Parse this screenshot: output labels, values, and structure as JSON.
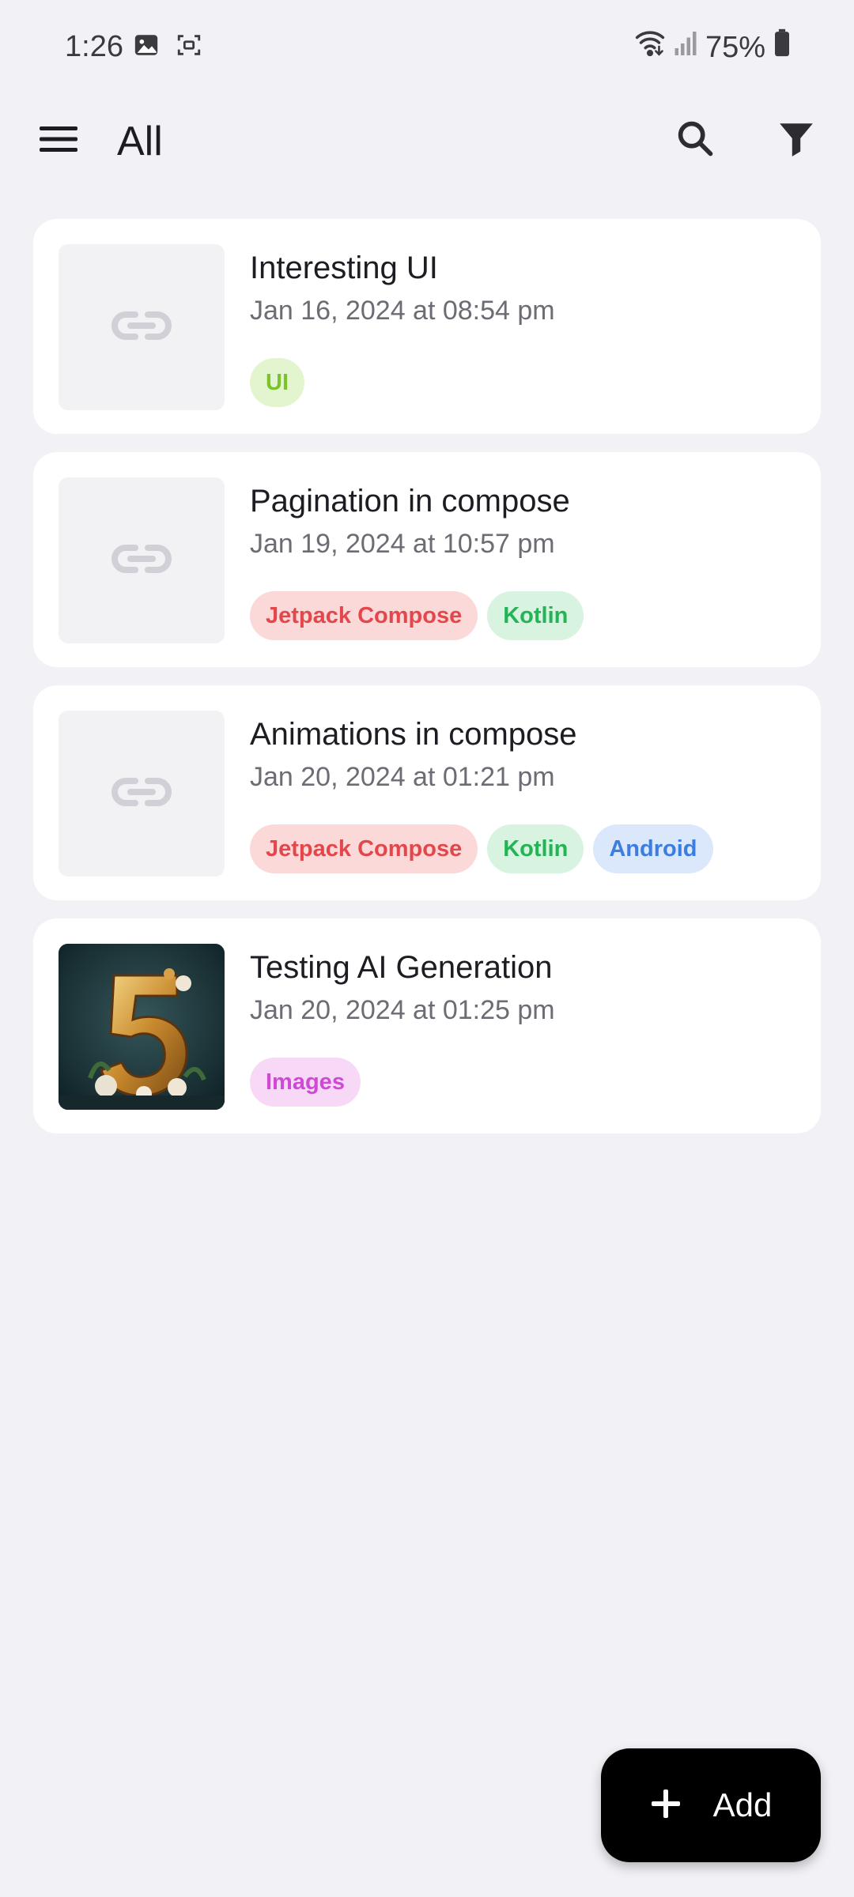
{
  "status_bar": {
    "time": "1:26",
    "battery": "75%",
    "icons": [
      "gallery-icon",
      "screenshot-icon",
      "wifi-icon",
      "signal-icon",
      "battery-icon"
    ]
  },
  "app_bar": {
    "title": "All",
    "icons": [
      "menu-icon",
      "search-icon",
      "filter-icon"
    ]
  },
  "colors": {
    "background": "#f1f1f6",
    "card": "#ffffff",
    "fab": "#000000"
  },
  "cards": [
    {
      "title": "Interesting UI",
      "date": "Jan 16, 2024 at 08:54 pm",
      "thumbnail": "link-icon",
      "tags": [
        {
          "label": "UI",
          "bg": "#e3f5cf",
          "fg": "#7cc22b"
        }
      ]
    },
    {
      "title": "Pagination in compose",
      "date": "Jan 19, 2024 at 10:57 pm",
      "thumbnail": "link-icon",
      "tags": [
        {
          "label": "Jetpack Compose",
          "bg": "#fbd9d9",
          "fg": "#e3474b"
        },
        {
          "label": "Kotlin",
          "bg": "#d8f3df",
          "fg": "#22b455"
        }
      ]
    },
    {
      "title": "Animations in compose",
      "date": "Jan 20, 2024 at 01:21 pm",
      "thumbnail": "link-icon",
      "tags": [
        {
          "label": "Jetpack Compose",
          "bg": "#fbd9d9",
          "fg": "#e3474b"
        },
        {
          "label": "Kotlin",
          "bg": "#d8f3df",
          "fg": "#22b455"
        },
        {
          "label": "Android",
          "bg": "#dbe7fa",
          "fg": "#3b7de0"
        }
      ]
    },
    {
      "title": "Testing AI Generation",
      "date": "Jan 20, 2024 at 01:25 pm",
      "thumbnail": "image-thumbnail",
      "tags": [
        {
          "label": "Images",
          "bg": "#f7d9f7",
          "fg": "#d049d6"
        }
      ]
    }
  ],
  "fab": {
    "label": "Add",
    "icon": "plus-icon"
  }
}
